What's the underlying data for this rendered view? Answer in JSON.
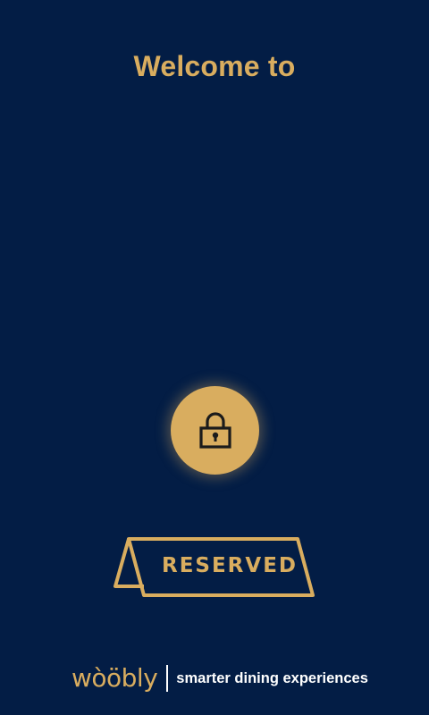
{
  "header": {
    "title": "Welcome to"
  },
  "unlock": {
    "icon": "lock-icon"
  },
  "sign": {
    "label": "RESERVED",
    "icon": "reserved-table-sign-icon"
  },
  "footer": {
    "logo": "wòöbly",
    "tagline": "smarter dining experiences"
  },
  "colors": {
    "background": "#031d45",
    "accent": "#d9ad5f",
    "text_light": "#ffffff"
  }
}
